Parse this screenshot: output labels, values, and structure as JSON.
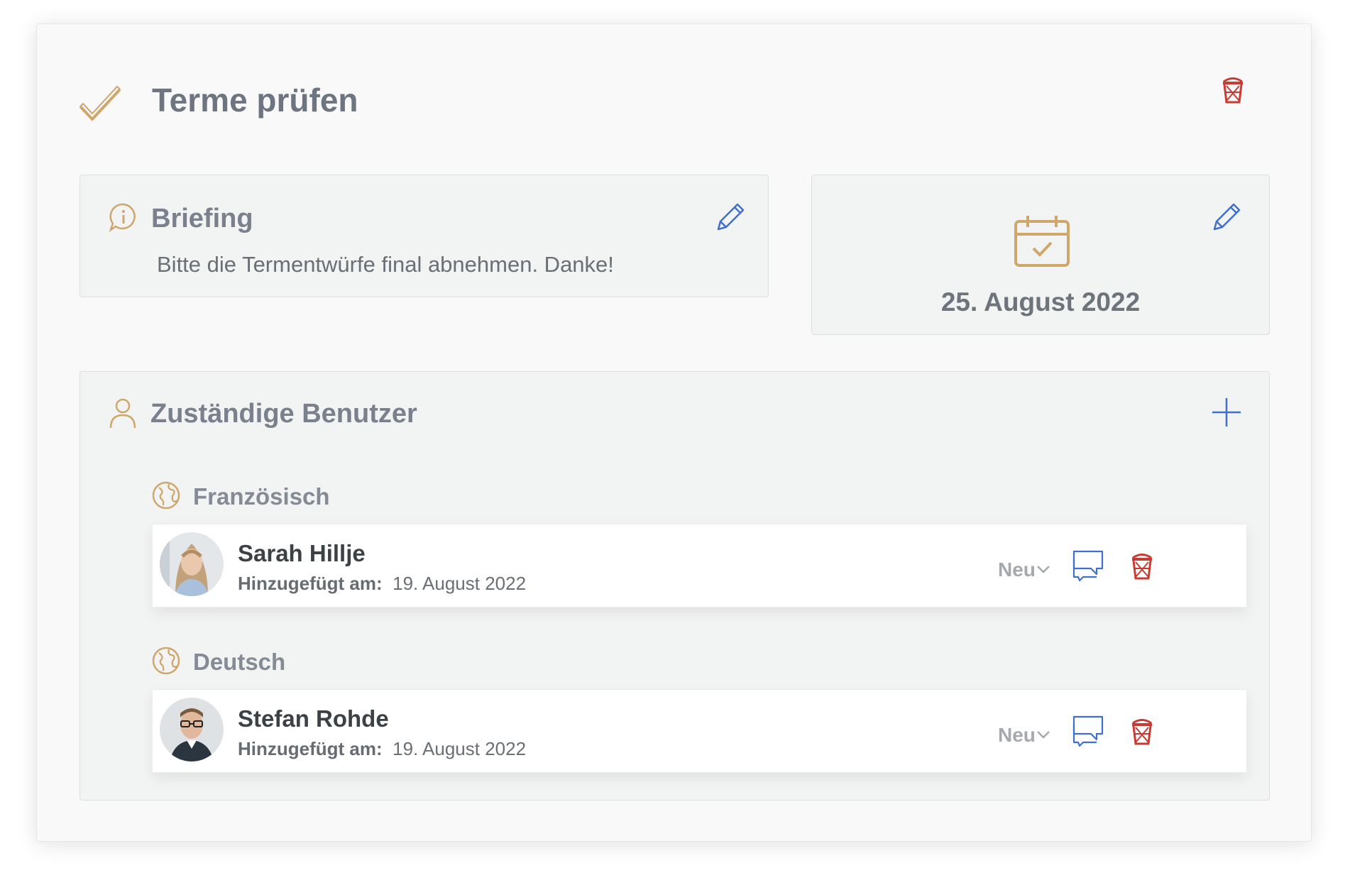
{
  "task": {
    "title": "Terme prüfen"
  },
  "briefing": {
    "title": "Briefing",
    "text": "Bitte die Termentwürfe final abnehmen. Danke!"
  },
  "due": {
    "date": "25. August 2022"
  },
  "users": {
    "title": "Zuständige Benutzer",
    "groups": [
      {
        "language": "Französisch",
        "user": {
          "name": "Sarah Hillje",
          "added_label": "Hinzugefügt am:",
          "added_date": "19. August 2022",
          "status": "Neu"
        }
      },
      {
        "language": "Deutsch",
        "user": {
          "name": "Stefan Rohde",
          "added_label": "Hinzugefügt am:",
          "added_date": "19. August 2022",
          "status": "Neu"
        }
      }
    ]
  },
  "colors": {
    "accent_gold": "#cfa66c",
    "action_blue": "#3f6fcf",
    "delete_red": "#c83a32",
    "title_gray": "#6d7580"
  },
  "icons": {
    "task": "checkmark-icon",
    "delete": "trash-icon",
    "info": "info-bubble-icon",
    "edit": "pencil-icon",
    "calendar": "calendar-check-icon",
    "user": "user-icon",
    "add": "plus-icon",
    "language": "globe-icon",
    "message": "message-icon",
    "dropdown": "chevron-down-icon"
  }
}
